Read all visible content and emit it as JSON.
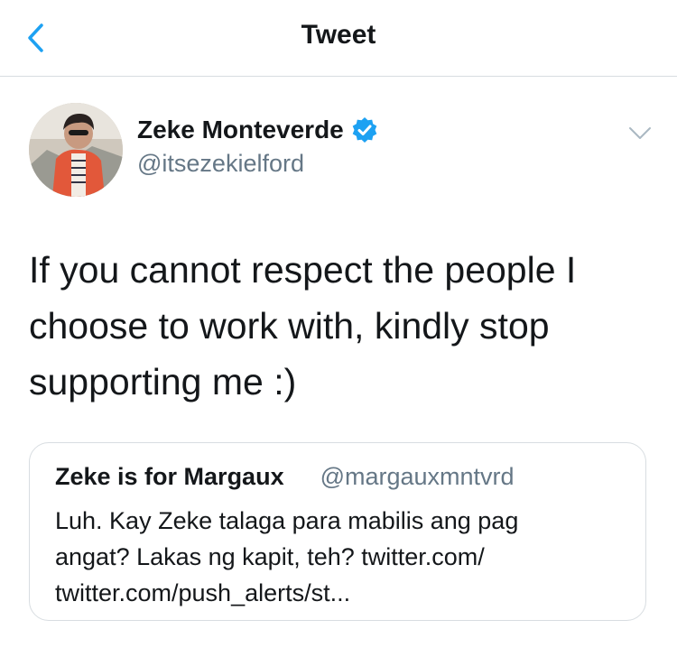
{
  "nav": {
    "title": "Tweet"
  },
  "author": {
    "name": "Zeke Monteverde",
    "handle": "@itsezekielford",
    "verified": true
  },
  "tweet": {
    "lines": [
      "If you cannot respect the people I",
      "choose to work with, kindly stop",
      "supporting me :)"
    ]
  },
  "quoted_tweet": {
    "name": "Zeke is for Margaux",
    "handle": "@margauxmntvrd",
    "lines": [
      "Luh. Kay Zeke talaga para mabilis ang pag",
      "angat? Lakas ng kapit, teh? twitter.com/",
      "twitter.com/push_alerts/st..."
    ]
  },
  "colors": {
    "accent": "#1da1f2",
    "text": "#14171a",
    "secondary_text": "#657786",
    "border": "#d8dde1"
  },
  "icons": {
    "back": "chevron-left-icon",
    "verified": "verified-badge-icon",
    "more": "chevron-down-icon"
  }
}
